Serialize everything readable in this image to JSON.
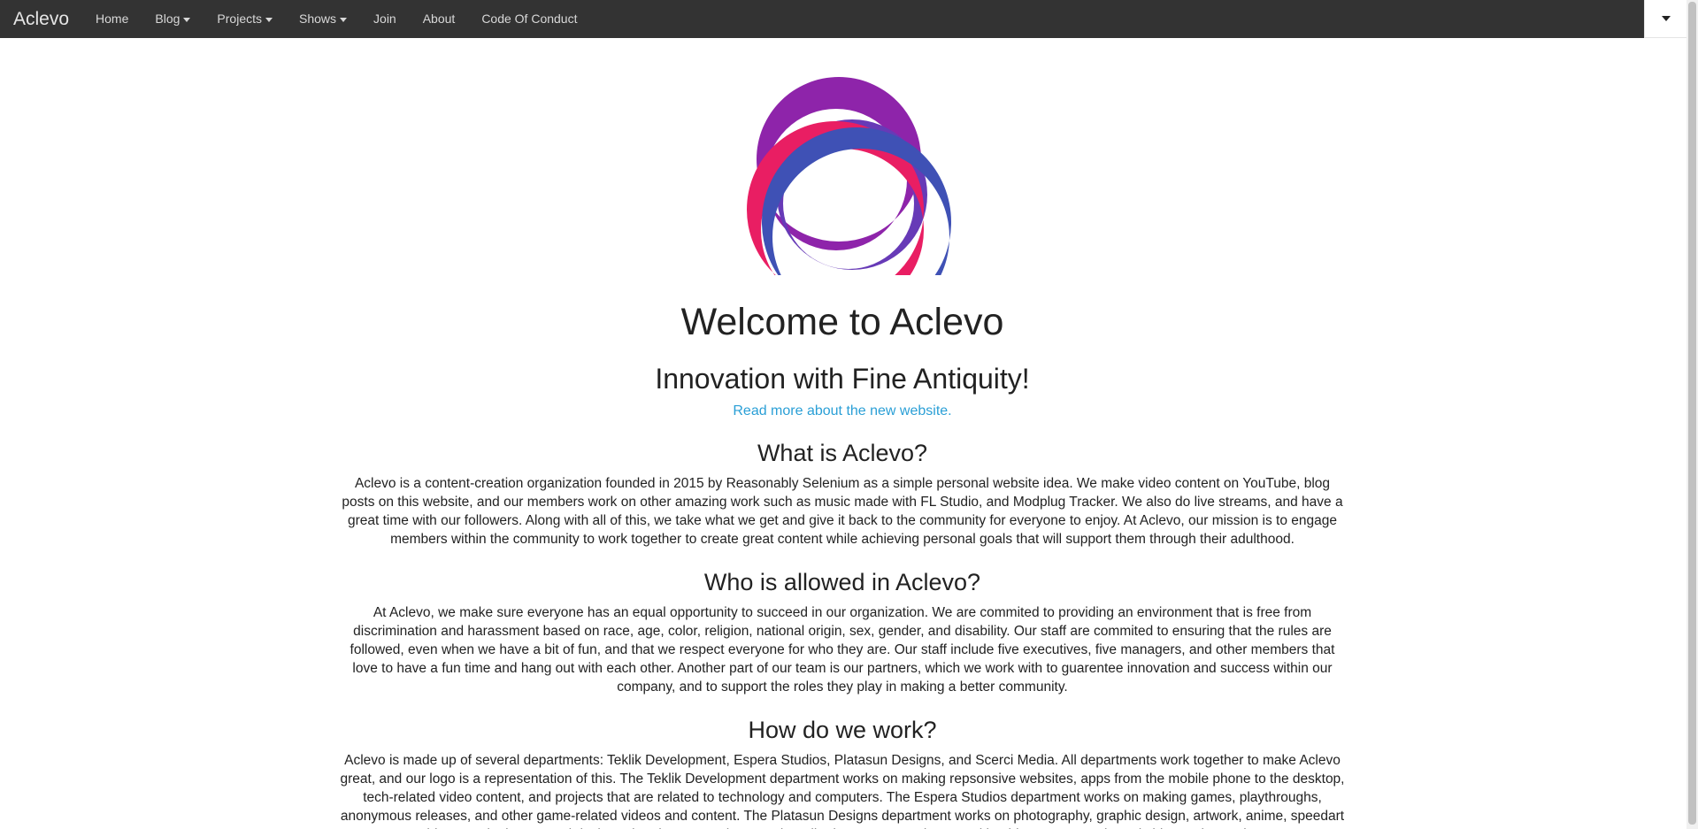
{
  "navbar": {
    "brand": "Aclevo",
    "items": [
      {
        "label": "Home",
        "dropdown": false
      },
      {
        "label": "Blog",
        "dropdown": true
      },
      {
        "label": "Projects",
        "dropdown": true
      },
      {
        "label": "Shows",
        "dropdown": true
      },
      {
        "label": "Join",
        "dropdown": false
      },
      {
        "label": "About",
        "dropdown": false
      },
      {
        "label": "Code Of Conduct",
        "dropdown": false
      }
    ]
  },
  "hero": {
    "title": "Welcome to Aclevo",
    "tagline": "Innovation with Fine Antiquity!",
    "link": "Read more about the new website."
  },
  "sections": [
    {
      "heading": "What is Aclevo?",
      "body": "Aclevo is a content-creation organization founded in 2015 by Reasonably Selenium as a simple personal website idea. We make video content on YouTube, blog posts on this website, and our members work on other amazing work such as music made with FL Studio, and Modplug Tracker. We also do live streams, and have a great time with our followers. Along with all of this, we take what we get and give it back to the community for everyone to enjoy. At Aclevo, our mission is to engage members within the community to work together to create great content while achieving personal goals that will support them through their adulthood."
    },
    {
      "heading": "Who is allowed in Aclevo?",
      "body": "At Aclevo, we make sure everyone has an equal opportunity to succeed in our organization. We are commited to providing an environment that is free from discrimination and harassment based on  race, age, color, religion, national origin, sex, gender, and disability. Our staff are commited to ensuring that the rules are followed, even when we have a bit of fun, and that we respect everyone for who they are. Our staff include five executives, five managers, and other members that love to have a fun time and hang out with each other. Another part of our team is our partners, which we work with to guarentee innovation and success within our company, and to support the roles they play in making a better community."
    },
    {
      "heading": "How do we work?",
      "body": "Aclevo is made up of several departments: Teklik Development, Espera Studios, Platasun Designs, and Scerci Media. All departments work together to make Aclevo great, and our logo is a representation of this. The Teklik Development department works on making repsonsive websites, apps from the mobile phone to the desktop, tech-related video content, and projects that are related to technology and computers. The Espera Studios department works on making games, playthroughs, anonymous releases, and other game-related videos and content. The Platasun Designs department works on photography, graphic design, artwork, anime, speedart videos, and other art and design related content. The Scerci Media department works on making blog posts, movie and video series' scripts"
    }
  ],
  "colors": {
    "navbar_bg": "#333333",
    "link": "#2a9fd6",
    "logo_purple": "#8e24aa",
    "logo_violet": "#673ab7",
    "logo_pink": "#e91e63",
    "logo_blue": "#3f51b5"
  },
  "icons": {
    "toggle": "caret-down-icon",
    "dropdown": "caret-icon",
    "logo": "aclevo-arc-logo"
  }
}
